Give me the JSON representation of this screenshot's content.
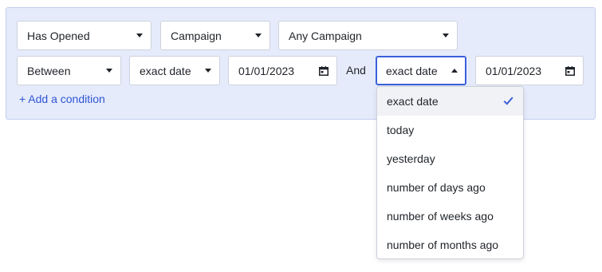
{
  "row1": {
    "event": "Has Opened",
    "target": "Campaign",
    "campaign": "Any Campaign"
  },
  "row2": {
    "operator": "Between",
    "start_type": "exact date",
    "start_date": "01/01/2023",
    "and_label": "And",
    "end_type": "exact date",
    "end_date": "01/01/2023"
  },
  "add_condition": "+ Add a condition",
  "dropdown": {
    "options": [
      {
        "label": "exact date",
        "selected": true
      },
      {
        "label": "today"
      },
      {
        "label": "yesterday"
      },
      {
        "label": "number of days ago"
      },
      {
        "label": "number of weeks ago"
      },
      {
        "label": "number of months ago"
      }
    ]
  },
  "colors": {
    "panel_bg": "#e5ebfb",
    "accent": "#3b5fd9",
    "link": "#2f55d4"
  },
  "icons": {
    "caret": "chevron-down-icon",
    "calendar": "calendar-icon",
    "check": "checkmark-icon"
  }
}
